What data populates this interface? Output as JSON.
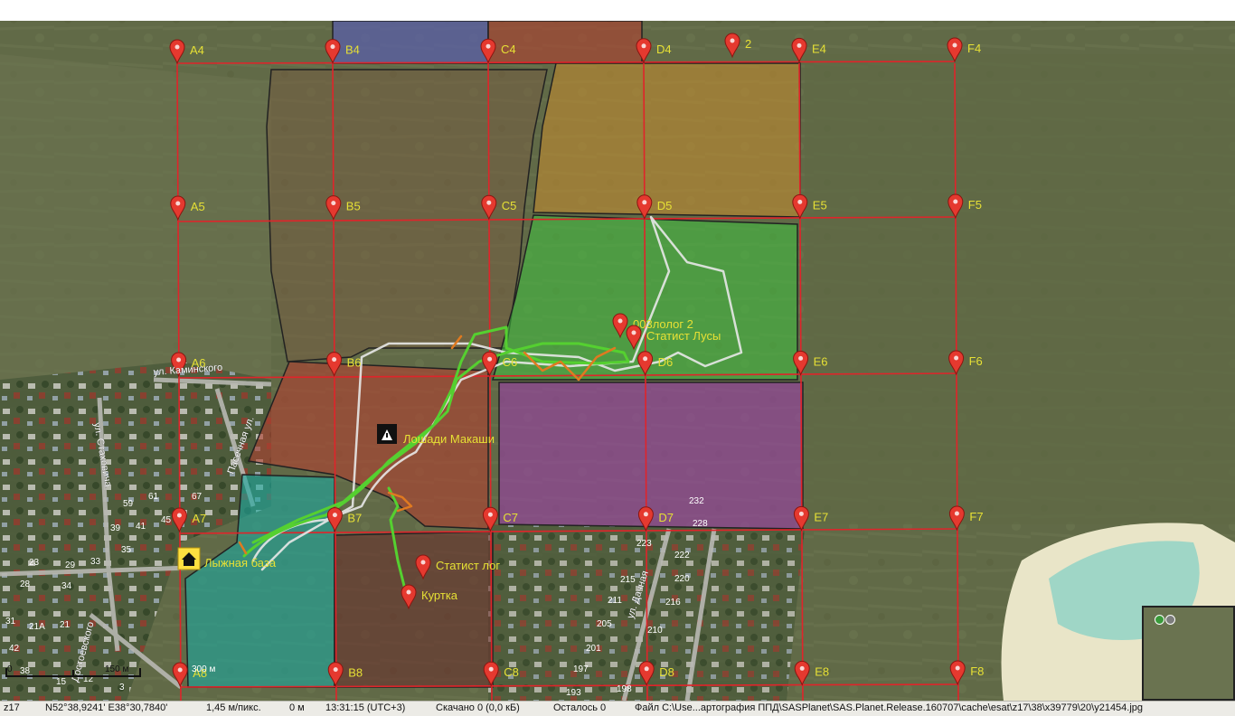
{
  "grid": {
    "columns": [
      "A",
      "B",
      "C",
      "D",
      "E",
      "F"
    ],
    "rows": [
      "4",
      "5",
      "6",
      "7",
      "8"
    ]
  },
  "extra_markers": [
    {
      "label": "2"
    },
    {
      "label": "003лолог 2"
    },
    {
      "label": "Статист Лусы"
    },
    {
      "label": "Статист лог"
    },
    {
      "label": "Куртка"
    }
  ],
  "poi": [
    {
      "label": "Лошади Макаши",
      "icon": "warning-icon"
    },
    {
      "label": "Лыжная база",
      "icon": "home-icon"
    }
  ],
  "street_labels": [
    "ул. Каминского",
    "ул. Стаховича",
    "Пасечная ул.",
    "ул. Дачная",
    "Достоевского"
  ],
  "house_numbers": [
    "232",
    "228",
    "223",
    "222",
    "215",
    "220",
    "211",
    "216",
    "205",
    "210",
    "201",
    "197",
    "193",
    "198",
    "59",
    "61",
    "67",
    "45",
    "39",
    "41",
    "35",
    "23",
    "29",
    "33",
    "28",
    "34",
    "21А",
    "21",
    "31",
    "42",
    "38",
    "15",
    "12",
    "3"
  ],
  "scale": {
    "label_1": "150 м",
    "label_2": "300 м",
    "zero": "0"
  },
  "status": {
    "zoom": "z17",
    "coords": "N52°38,9241' E38°30,7840'",
    "resolution": "1,45 м/пикс.",
    "distance": "0 м",
    "time": "13:31:15 (UTC+3)",
    "downloaded": "Скачано 0 (0,0 кБ)",
    "remaining": "Осталось 0",
    "file": "Файл C:\\Use...артография ППД\\SASPlanet\\SAS.Planet.Release.160707\\cache\\esat\\z17\\38\\x39779\\20\\y21454.jpg"
  },
  "colors": {
    "grid_line": "#e0242a",
    "marker": "#e5392f",
    "label": "#e6e035",
    "zone_blue": "#5a5fa8",
    "zone_red": "#b04030",
    "zone_orange": "#c08a30",
    "zone_brown": "#7a5a40",
    "zone_green": "#3fc23f",
    "zone_purple": "#9b3ea8",
    "zone_cyan": "#1aa8a0",
    "zone_darkred": "#6a2a2a",
    "track_green": "#55d030",
    "track_orange": "#e07a20",
    "track_white": "#e8e8e8"
  }
}
